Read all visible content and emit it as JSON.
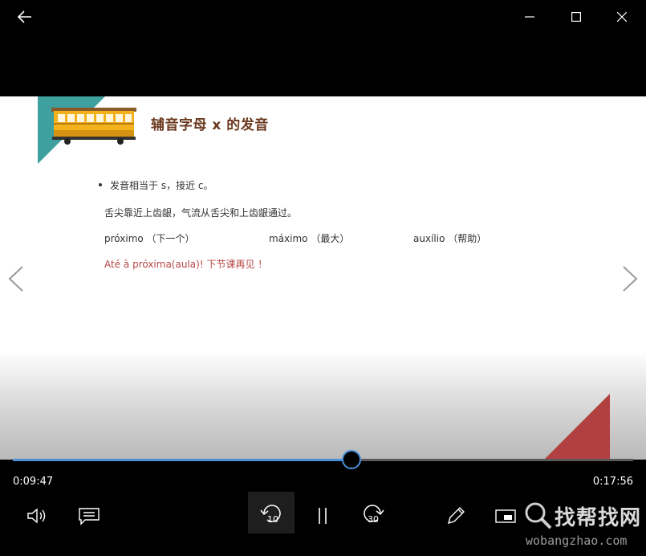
{
  "window": {
    "back_icon": "arrow-left-icon",
    "minimize_icon": "minimize-icon",
    "maximize_icon": "maximize-icon",
    "close_icon": "close-icon"
  },
  "slide": {
    "title": "辅音字母 x 的发音",
    "bullet_line": "发音相当于 s，接近 c。",
    "description": "舌尖靠近上齿龈，气流从舌尖和上齿龈通过。",
    "examples": [
      "próximo （下一个）",
      "máximo （最大）",
      "auxílio （帮助）"
    ],
    "farewell": "Até à próxima(aula)! 下节课再见 ！",
    "colors": {
      "title": "#6b3a1e",
      "farewell": "#b84545",
      "teal": "#3fa0a0",
      "red_corner": "#b34040"
    }
  },
  "player": {
    "elapsed": "0:09:47",
    "total": "0:17:56",
    "progress": 0.5456,
    "skip_back_seconds": "10",
    "skip_forward_seconds": "30",
    "accent_color": "#4a90d9",
    "controls": {
      "volume_icon": "volume-icon",
      "captions_icon": "captions-icon",
      "pause_icon": "pause-icon",
      "pen_icon": "pen-icon",
      "miniview_icon": "miniview-icon"
    }
  },
  "watermark": {
    "main": "找帮找网",
    "sub": "wobangzhao.com"
  }
}
